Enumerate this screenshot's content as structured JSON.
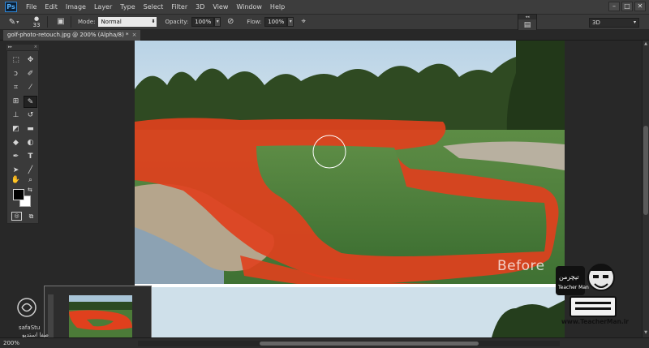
{
  "app": {
    "logo": "Ps",
    "menu": [
      "File",
      "Edit",
      "Image",
      "Layer",
      "Type",
      "Select",
      "Filter",
      "3D",
      "View",
      "Window",
      "Help"
    ],
    "window_controls": [
      "–",
      "□",
      "✕"
    ]
  },
  "options": {
    "brush_size": "33",
    "mode_label": "Mode:",
    "mode_value": "Normal",
    "opacity_label": "Opacity:",
    "opacity_value": "100%",
    "flow_label": "Flow:",
    "flow_value": "100%",
    "workspace": "3D"
  },
  "document": {
    "tab_title": "golf-photo-retouch.jpg @ 200% (Alpha/8) *",
    "close": "×"
  },
  "canvas": {
    "before_label": "Before"
  },
  "status": {
    "zoom": "200%"
  },
  "watermark": {
    "teacher_url": "www.TeacherMan.ir",
    "teacher_name": "Teacher Man",
    "teacher_fa": "تیچرمن",
    "safa_name": "safaStu",
    "safa_fa": "صفا استدیو"
  },
  "colors": {
    "overlay_red": "#e0401d",
    "accent_blue": "#2e86d6"
  }
}
